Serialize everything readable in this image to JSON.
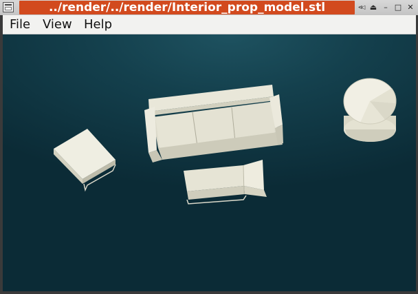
{
  "window": {
    "title": "../render/../render/Interior_prop_model.stl",
    "controls": {
      "pin": "⊲◁",
      "shade": "⏏",
      "minimize": "–",
      "maximize": "□",
      "close": "✕"
    }
  },
  "menubar": {
    "items": [
      {
        "label": "File"
      },
      {
        "label": "View"
      },
      {
        "label": "Help"
      }
    ]
  },
  "viewport": {
    "background_top": "#1e5260",
    "background_bottom": "#0b2b36",
    "model_color": "#e6e4d6"
  }
}
